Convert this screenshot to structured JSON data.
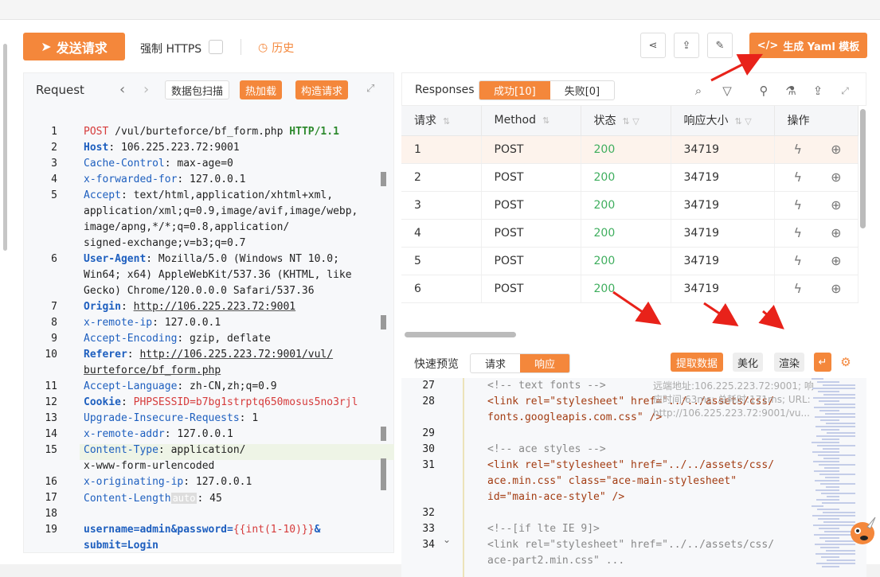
{
  "toolbar": {
    "send_label": "发送请求",
    "https_label": "强制 HTTPS",
    "history_label": "历史",
    "yaml_label": "生成 Yaml 模板"
  },
  "request": {
    "title": "Request",
    "btn_capture": "数据包扫描",
    "btn_hotload": "热加载",
    "btn_construct": "构造请求",
    "lines": [
      {
        "n": "1",
        "parts": [
          [
            "POST",
            "red"
          ],
          [
            " /vul/burteforce/bf_form.php ",
            ""
          ],
          [
            "HTTP/1.1",
            "grn"
          ]
        ]
      },
      {
        "n": "2",
        "parts": [
          [
            "Host",
            "kb"
          ],
          [
            ": 106.225.223.72:9001",
            ""
          ]
        ]
      },
      {
        "n": "3",
        "parts": [
          [
            "Cache-Control",
            "k"
          ],
          [
            ": max-age=0",
            ""
          ]
        ]
      },
      {
        "n": "4",
        "parts": [
          [
            "x-forwarded-for",
            "k"
          ],
          [
            ": 127.0.0.1",
            ""
          ]
        ]
      },
      {
        "n": "5",
        "parts": [
          [
            "Accept",
            "k"
          ],
          [
            ": text/html,application/xhtml+xml,",
            ""
          ]
        ]
      },
      {
        "n": "",
        "parts": [
          [
            "application/xml;q=0.9,image/avif,image/webp,",
            ""
          ]
        ]
      },
      {
        "n": "",
        "parts": [
          [
            "image/apng,*/*;q=0.8,application/",
            ""
          ]
        ]
      },
      {
        "n": "",
        "parts": [
          [
            "signed-exchange;v=b3;q=0.7",
            ""
          ]
        ]
      },
      {
        "n": "6",
        "parts": [
          [
            "User-Agent",
            "kb"
          ],
          [
            ": Mozilla/5.0 (Windows NT 10.0;",
            ""
          ]
        ]
      },
      {
        "n": "",
        "parts": [
          [
            "Win64; x64) AppleWebKit/537.36 (KHTML, like",
            ""
          ]
        ]
      },
      {
        "n": "",
        "parts": [
          [
            "Gecko) Chrome/120.0.0.0 Safari/537.36",
            ""
          ]
        ]
      },
      {
        "n": "7",
        "parts": [
          [
            "Origin",
            "kb"
          ],
          [
            ": ",
            ""
          ],
          [
            "http://106.225.223.72:9001",
            "u"
          ]
        ]
      },
      {
        "n": "8",
        "parts": [
          [
            "x-remote-ip",
            "k"
          ],
          [
            ": 127.0.0.1",
            ""
          ]
        ]
      },
      {
        "n": "9",
        "parts": [
          [
            "Accept-Encoding",
            "k"
          ],
          [
            ": gzip, deflate",
            ""
          ]
        ]
      },
      {
        "n": "10",
        "parts": [
          [
            "Referer",
            "kb"
          ],
          [
            ": ",
            ""
          ],
          [
            "http://106.225.223.72:9001/vul/",
            "u"
          ]
        ]
      },
      {
        "n": "",
        "parts": [
          [
            "burteforce/bf_form.php",
            "u"
          ]
        ]
      },
      {
        "n": "11",
        "parts": [
          [
            "Accept-Language",
            "k"
          ],
          [
            ": zh-CN,zh;q=0.9",
            ""
          ]
        ]
      },
      {
        "n": "12",
        "parts": [
          [
            "Cookie",
            "kb"
          ],
          [
            ": ",
            ""
          ],
          [
            "PHPSESSID",
            "red"
          ],
          [
            "=b7bg1strptq650mosus5no3rjl",
            "red"
          ]
        ]
      },
      {
        "n": "13",
        "parts": [
          [
            "Upgrade-Insecure-Requests",
            "k"
          ],
          [
            ": 1",
            ""
          ]
        ]
      },
      {
        "n": "14",
        "parts": [
          [
            "x-remote-addr",
            "k"
          ],
          [
            ": 127.0.0.1",
            ""
          ]
        ]
      },
      {
        "n": "15",
        "parts": [
          [
            "Content-Type",
            "k"
          ],
          [
            ": application/",
            ""
          ]
        ]
      },
      {
        "n": "",
        "parts": [
          [
            "x-www-form-urlencoded",
            ""
          ]
        ]
      },
      {
        "n": "16",
        "parts": [
          [
            "x-originating-ip",
            "k"
          ],
          [
            ": 127.0.0.1",
            ""
          ]
        ]
      },
      {
        "n": "17",
        "parts": [
          [
            "Content-Length",
            "k"
          ],
          [
            "auto",
            "auto"
          ],
          [
            ": 45",
            ""
          ]
        ]
      },
      {
        "n": "18",
        "parts": []
      },
      {
        "n": "19",
        "parts": [
          [
            "username=admin&password=",
            "kb"
          ],
          [
            "{{int(1-10)}}",
            "red"
          ],
          [
            "&",
            "kb"
          ]
        ]
      },
      {
        "n": "",
        "parts": [
          [
            "submit=Login",
            "kb"
          ]
        ]
      }
    ]
  },
  "responses": {
    "title": "Responses",
    "tab_success": "成功[10]",
    "tab_fail": "失败[0]",
    "columns": [
      "请求",
      "Method",
      "状态",
      "响应大小",
      "操作"
    ],
    "rows": [
      {
        "id": "1",
        "method": "POST",
        "status": "200",
        "size": "34719"
      },
      {
        "id": "2",
        "method": "POST",
        "status": "200",
        "size": "34719"
      },
      {
        "id": "3",
        "method": "POST",
        "status": "200",
        "size": "34719"
      },
      {
        "id": "4",
        "method": "POST",
        "status": "200",
        "size": "34719"
      },
      {
        "id": "5",
        "method": "POST",
        "status": "200",
        "size": "34719"
      },
      {
        "id": "6",
        "method": "POST",
        "status": "200",
        "size": "34719"
      }
    ]
  },
  "preview": {
    "title": "快速预览",
    "tab_request": "请求",
    "tab_response": "响应",
    "btn_extract": "提取数据",
    "btn_beautify": "美化",
    "btn_render": "渲染",
    "tooltip": "远端地址:106.225.223.72:9001; 响应时间:63ms; 总耗时:171ms; URL: http://106.225.223.72:9001/vu...",
    "lines": [
      {
        "n": "27",
        "text": "<!-- text fonts -->",
        "type": "cmt"
      },
      {
        "n": "28",
        "text": "<link rel=\"stylesheet\" href=\"../../assets/css/",
        "type": "link1"
      },
      {
        "n": "",
        "text": "fonts.googleapis.com.css\" />",
        "type": "link1b"
      },
      {
        "n": "29",
        "text": "",
        "type": "blank"
      },
      {
        "n": "30",
        "text": "<!-- ace styles -->",
        "type": "cmt"
      },
      {
        "n": "31",
        "text": "<link rel=\"stylesheet\" href=\"../../assets/css/",
        "type": "link2"
      },
      {
        "n": "",
        "text": "ace.min.css\" class=\"ace-main-stylesheet\"",
        "type": "link2b"
      },
      {
        "n": "",
        "text": "id=\"main-ace-style\" />",
        "type": "link2c"
      },
      {
        "n": "32",
        "text": "",
        "type": "blank"
      },
      {
        "n": "33",
        "text": "<!--[if lte IE 9]>",
        "type": "cmt"
      },
      {
        "n": "34",
        "text": "<link rel=\"stylesheet\" href=\"../../assets/css/",
        "type": "cmt"
      },
      {
        "n": "",
        "text": "ace-part2.min.css\" ...",
        "type": "cmt"
      }
    ]
  },
  "colors": {
    "accent": "#f4873b",
    "status_ok": "#3fae5e",
    "key": "#1e5fbf",
    "arrow": "#e8221a"
  }
}
